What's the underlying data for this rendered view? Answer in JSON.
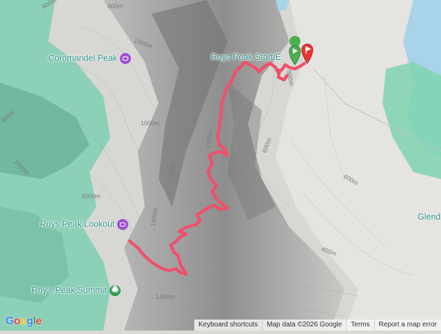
{
  "map": {
    "places": {
      "coromandel_peak": "Coromandel Peak",
      "roys_peak_start": "Roys Peak Start/E",
      "roys_peak_lookout": "Roys Peak Lookout",
      "roys_peak_summit": "Roy's Peak Summit",
      "glenorchy_partial": "Glend"
    },
    "contours": {
      "c1": "600m",
      "c2": "1000m",
      "c3": "800m",
      "c4": "1000m",
      "c5": "600m",
      "c6": "1000m",
      "c7": "1400m",
      "c8": "1400m",
      "c9": "600m",
      "c10": "600m",
      "c11": "1000m",
      "c12": "1400m",
      "c13": "800m",
      "c14": "400m",
      "c15": "1000m"
    },
    "colors": {
      "route": "#f0506a",
      "start_marker": "#4caf50",
      "end_marker": "#e53935",
      "water": "#a8d3e8",
      "vegetation": "#7fd3b0",
      "place_label": "#2f8f86"
    }
  },
  "attribution": {
    "keyboard_shortcuts": "Keyboard shortcuts",
    "map_data": "Map data ©2026 Google",
    "terms": "Terms",
    "report": "Report a map error"
  },
  "google_logo": "Google"
}
